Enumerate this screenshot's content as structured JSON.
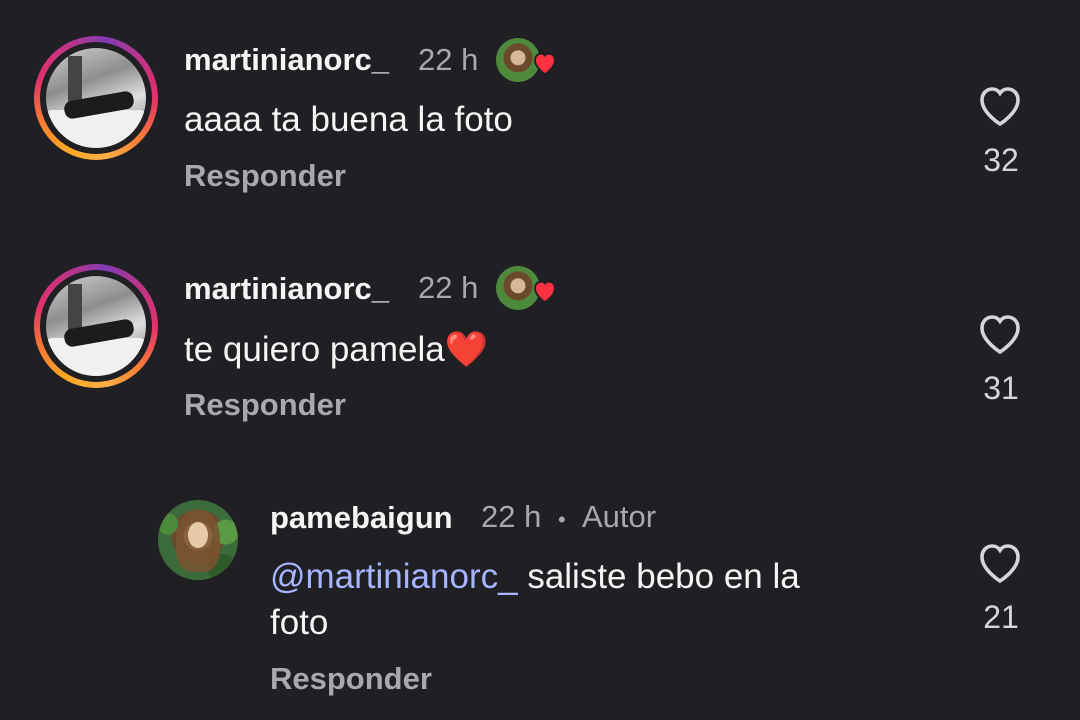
{
  "comments": [
    {
      "username": "martinianorc_",
      "time": "22 h",
      "text": "aaaa ta buena la foto",
      "reply_label": "Responder",
      "likes": "32",
      "liked_by_author": true
    },
    {
      "username": "martinianorc_",
      "time": "22 h",
      "text": "te quiero pamela",
      "text_emoji": "❤️",
      "reply_label": "Responder",
      "likes": "31",
      "liked_by_author": true
    },
    {
      "username": "pamebaigun",
      "time": "22 h",
      "separator": "•",
      "author_label": "Autor",
      "mention": "@martinianorc_",
      "text": "saliste bebo en la",
      "text_line2": "foto",
      "reply_label": "Responder",
      "likes": "21"
    }
  ],
  "colors": {
    "background": "#1f1f24",
    "mention": "#a7b4ff",
    "secondary_text": "#a8a8ad",
    "heart_red": "#ff3040"
  },
  "icons": {
    "like": "heart-outline-icon",
    "author_liked": "red-heart-icon"
  }
}
